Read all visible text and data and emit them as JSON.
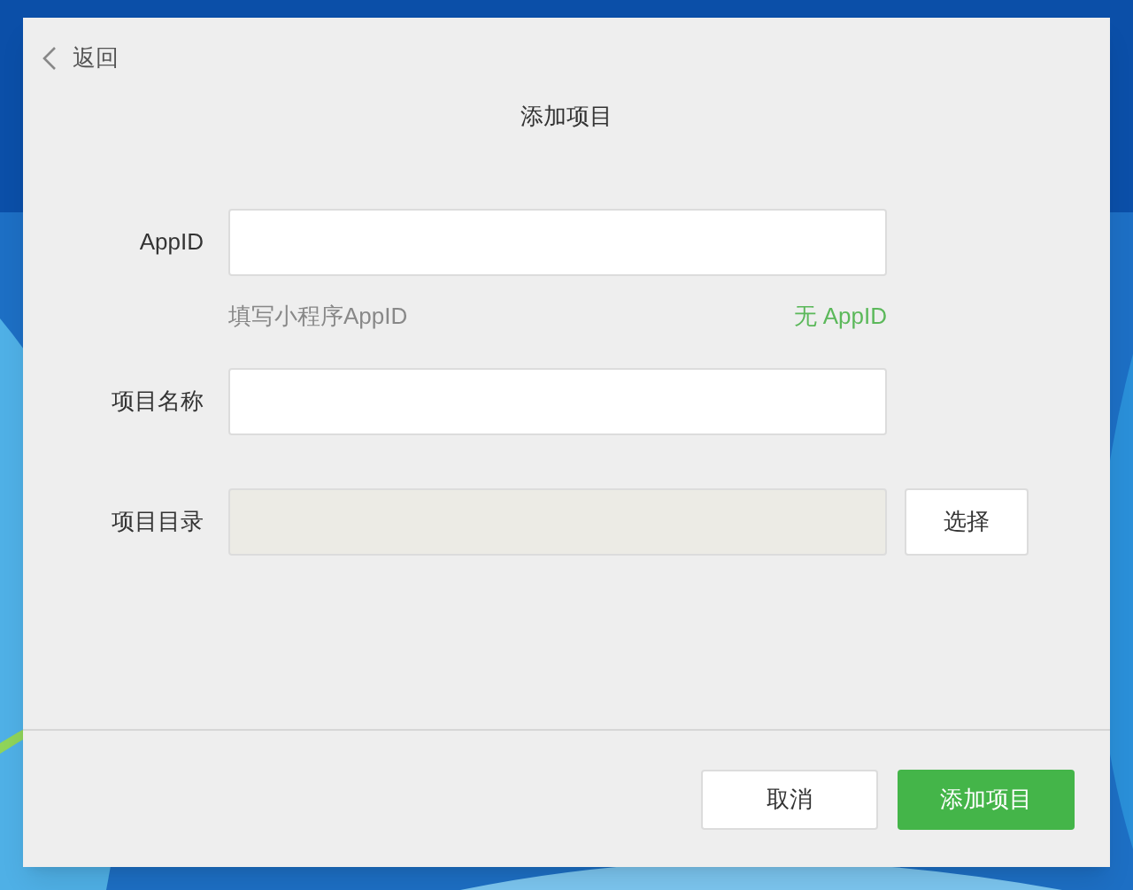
{
  "dialog": {
    "back": "返回",
    "title": "添加项目",
    "fields": [
      {
        "kind": "text",
        "label": "AppID",
        "disabled": false,
        "hint": "填写小程序AppID",
        "link": "无 AppID"
      },
      {
        "kind": "text",
        "label": "项目名称",
        "disabled": false
      },
      {
        "kind": "directory",
        "label": "项目目录",
        "disabled": true,
        "button": "选择"
      }
    ],
    "buttons": [
      {
        "kind": "secondary",
        "label": "取消"
      },
      {
        "kind": "primary",
        "label": "添加项目"
      }
    ]
  }
}
